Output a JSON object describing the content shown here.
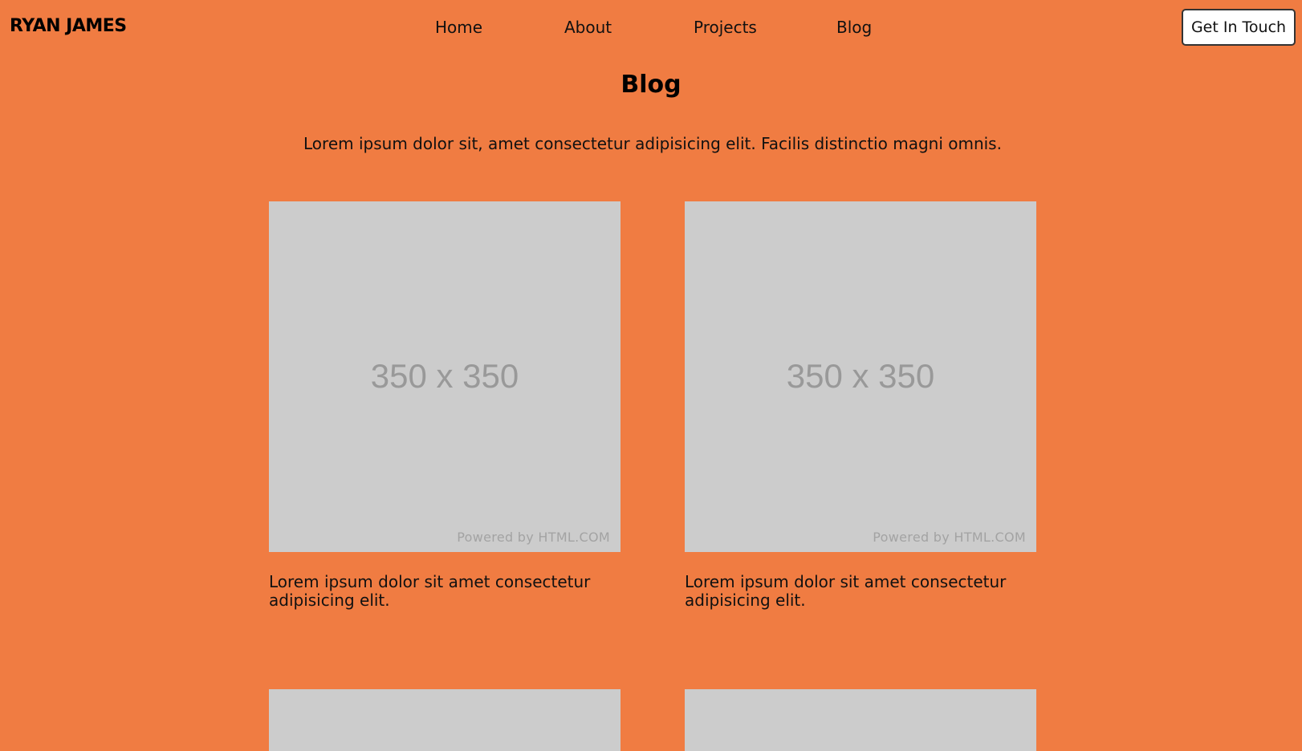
{
  "header": {
    "logo": "RYAN JAMES",
    "nav": [
      {
        "label": "Home"
      },
      {
        "label": "About"
      },
      {
        "label": "Projects"
      },
      {
        "label": "Blog"
      }
    ],
    "cta_label": "Get In Touch"
  },
  "main": {
    "title": "Blog",
    "intro": "Lorem ipsum dolor sit, amet consectetur adipisicing elit. Facilis distinctio magni omnis.",
    "posts": [
      {
        "image_size_label": "350 x 350",
        "image_credit": "Powered by HTML.COM",
        "text": "Lorem ipsum dolor sit amet consectetur adipisicing elit."
      },
      {
        "image_size_label": "350 x 350",
        "image_credit": "Powered by HTML.COM",
        "text": "Lorem ipsum dolor sit amet consectetur adipisicing elit."
      }
    ]
  },
  "colors": {
    "background": "#f07c42",
    "placeholder": "#cccccc",
    "text": "#111111"
  }
}
